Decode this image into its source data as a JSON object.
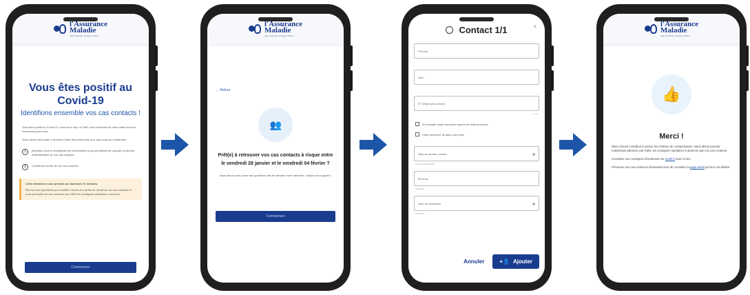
{
  "brand": {
    "name_line1": "l'Assurance",
    "name_line2": "Maladie",
    "tagline": "Agir ensemble, protéger chacun"
  },
  "screen1": {
    "title": "Vous êtes positif au Covid-19",
    "subtitle": "Identifions ensemble vos cas contacts !",
    "para1": "Vous êtes positif au Covid-19. Vous avez reçu un SMS vous informant de votre statut et nous remerçions pour cela.",
    "para2": "Nous allons vous aider à dresser la liste des personnes que vous avez pu contaminer.",
    "step1": "Identifiez-vous et renseignez les informations nous permettant de calculer la période d'identification de vos cas contacts",
    "step2": "Constituez la liste de vos cas contacts",
    "info_bold": "Cette démarche vous prendra au maximum 10 minutes.",
    "info_text": "Elle est très importante pour faciliter l'accès aux arrêts de travail de vos cas contacts et nous permettre de leur adresser par SMS les consignes sanitaires à observer.",
    "cta": "Commencer"
  },
  "screen2": {
    "back": "Retour",
    "question": "Prêt(e) à retrouver vos cas contacts à risque entre le vendredi 28 janvier et le vendredi 04 février ?",
    "text": "Nous allons vous poser des questions afin de stimuler votre mémoire. Laissez-vous guider !",
    "cta": "Commencer"
  },
  "screen3": {
    "title": "Contact 1/1",
    "close": "×",
    "firstname_placeholder": "Prénom",
    "lastname_placeholder": "Nom",
    "phone_placeholder": "Téléphone portable",
    "phone_counter": "0 / 15",
    "check1": "Je souhaite rester anonyme auprès de cette personne",
    "check2": "Cette personne vit dans mon foyer",
    "lastdate_placeholder": "Date de dernier contact",
    "lastdate_helper": "Format JJ/MM/AAAA",
    "email_placeholder": "Email",
    "email_helper": "Optionnel",
    "birthdate_placeholder": "Date de naissance",
    "birthdate_helper": "Optionnel",
    "cancel": "Annuler",
    "add": "Ajouter"
  },
  "screen4": {
    "title": "Merci !",
    "p1": "Merci d'avoir contribué à casser les chaînes de contamination. Nous allons pouvoir maintenant adresser par SMS, les consignes sanitaires à observer par vos cas contacts.",
    "p2_prefix": "Consulter vos consignes d'isolement sur ",
    "p2_link": "ameli.fr",
    "p2_suffix": " avec le lien",
    "p3_prefix": "Prévenez vos cas contact et demandez-leur de consulter la ",
    "p3_link": "page ameli",
    "p3_suffix": " qui leur est dédiée."
  },
  "colors": {
    "brand_blue": "#1a3c8f",
    "arrow_blue": "#1d56a8",
    "info_bg": "#fdf1dd",
    "icon_light": "#e6f0fb"
  }
}
